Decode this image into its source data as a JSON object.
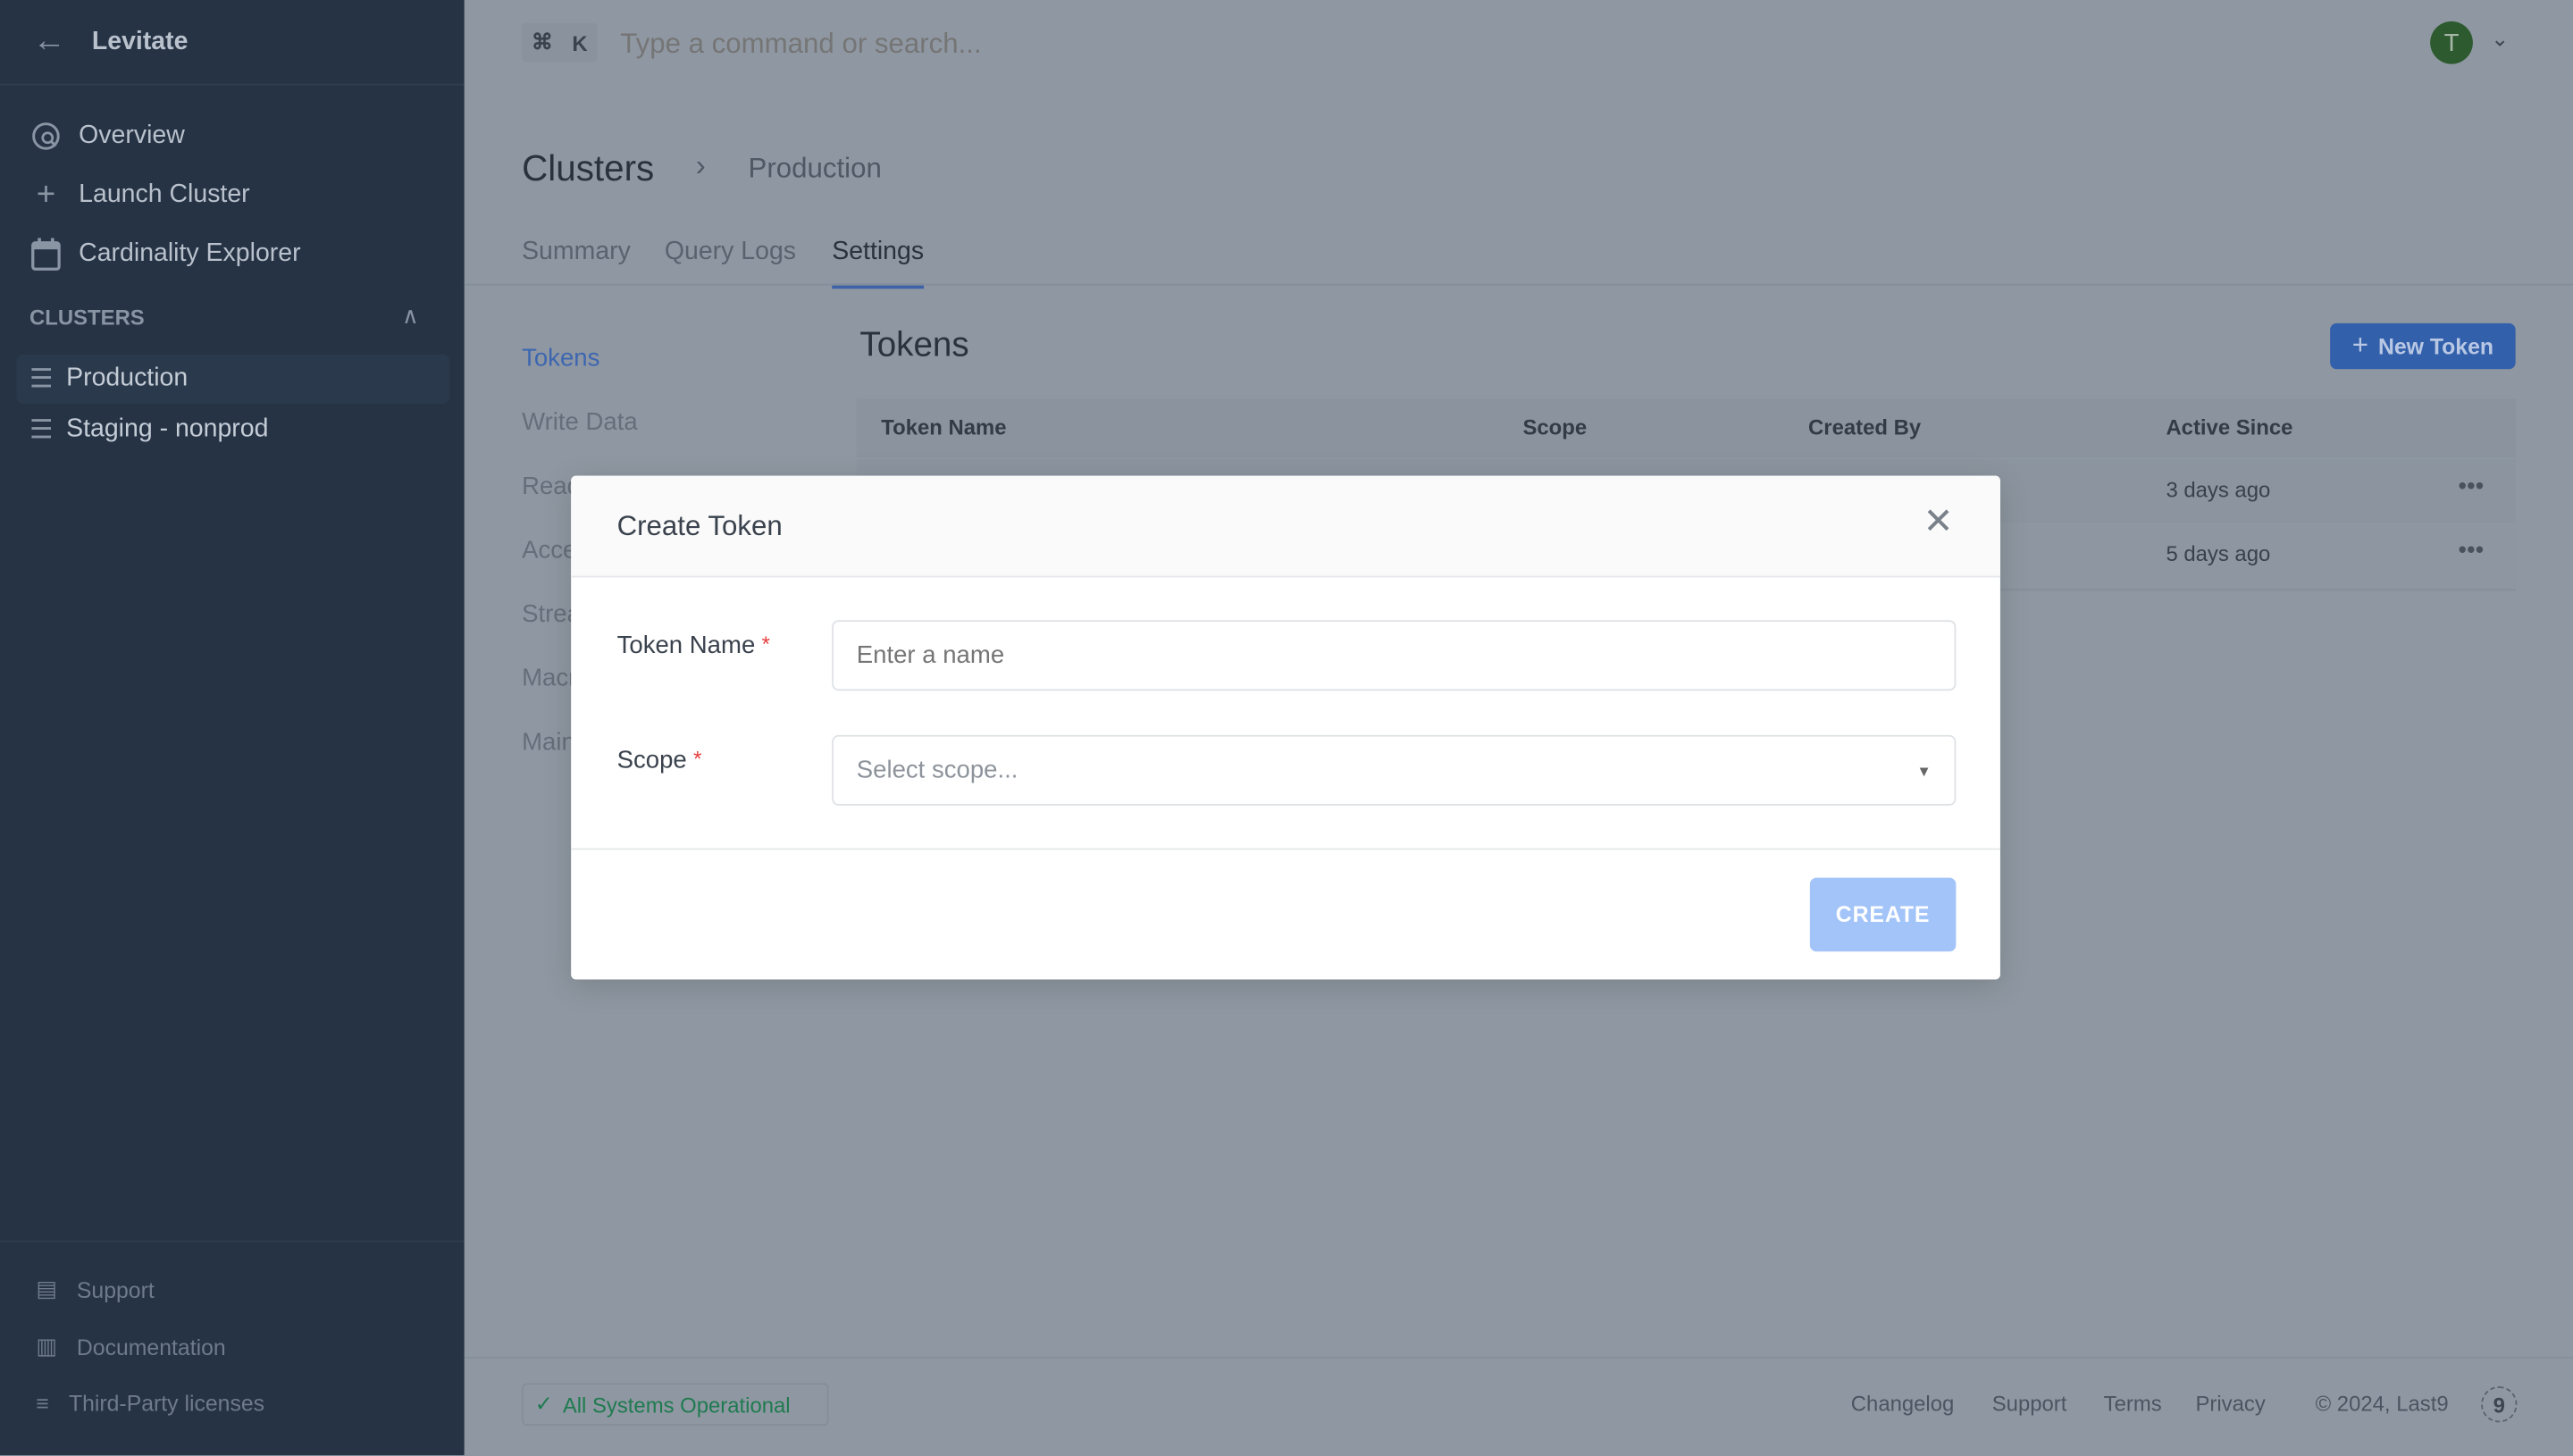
{
  "sidebar": {
    "app_name": "Levitate",
    "nav": [
      {
        "label": "Overview",
        "icon": "overview-icon"
      },
      {
        "label": "Launch Cluster",
        "icon": "plus-icon"
      },
      {
        "label": "Cardinality Explorer",
        "icon": "calendar-icon"
      }
    ],
    "section_title": "CLUSTERS",
    "clusters": [
      {
        "label": "Production",
        "active": true
      },
      {
        "label": "Staging - nonprod",
        "active": false
      }
    ],
    "bottom": [
      {
        "label": "Support"
      },
      {
        "label": "Documentation"
      },
      {
        "label": "Third-Party licenses"
      }
    ]
  },
  "topbar": {
    "shortcut_cmd": "⌘",
    "shortcut_key": "K",
    "search_placeholder": "Type a command or search...",
    "avatar_initial": "T",
    "avatar_color": "#2d5a2f"
  },
  "breadcrumb": {
    "root": "Clusters",
    "current": "Production"
  },
  "tabs": [
    {
      "label": "Summary"
    },
    {
      "label": "Query Logs"
    },
    {
      "label": "Settings",
      "active": true
    }
  ],
  "settings_nav": [
    "Tokens",
    "Write Data",
    "Read",
    "Access",
    "Streams",
    "Macros",
    "Maintenance"
  ],
  "tokens": {
    "title": "Tokens",
    "new_button": "New Token",
    "columns": [
      "Token Name",
      "Scope",
      "Created By",
      "Active Since"
    ],
    "rows": [
      {
        "active_since": "3 days ago"
      },
      {
        "active_since": "5 days ago"
      }
    ]
  },
  "footer": {
    "status": "All Systems Operational",
    "links": [
      "Changelog",
      "Support",
      "Terms",
      "Privacy"
    ],
    "copyright": "© 2024, Last9"
  },
  "modal": {
    "title": "Create Token",
    "name_label": "Token Name",
    "name_placeholder": "Enter a name",
    "scope_label": "Scope",
    "scope_placeholder": "Select scope...",
    "required_mark": "*",
    "create_button": "CREATE"
  },
  "colors": {
    "accent": "#3f6fc4",
    "create_disabled": "#a3c4f8"
  }
}
